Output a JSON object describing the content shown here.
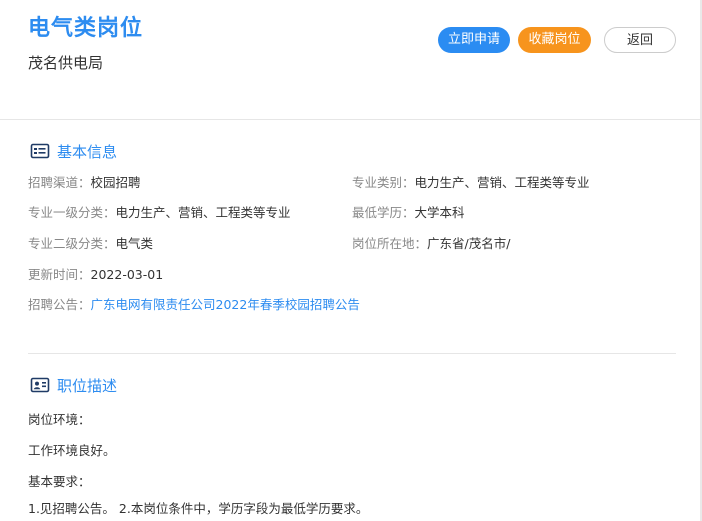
{
  "header": {
    "title": "电气类岗位",
    "company": "茂名供电局",
    "apply_label": "立即申请",
    "favorite_label": "收藏岗位",
    "back_label": "返回"
  },
  "basic_info": {
    "heading": "基本信息",
    "icon": "id-card-icon",
    "recruit_channel_key": "招聘渠道：",
    "recruit_channel_val": "校园招聘",
    "major_category_key": "专业类别：",
    "major_category_val": "电力生产、营销、工程类等专业",
    "major_l1_key": "专业一级分类：",
    "major_l1_val": "电力生产、营销、工程类等专业",
    "min_edu_key": "最低学历：",
    "min_edu_val": "大学本科",
    "major_l2_key": "专业二级分类：",
    "major_l2_val": "电气类",
    "location_key": "岗位所在地：",
    "location_val": "广东省/茂名市/",
    "updated_key": "更新时间：",
    "updated_val": "2022-03-01",
    "notice_key": "招聘公告：",
    "notice_link": "广东电网有限责任公司2022年春季校园招聘公告"
  },
  "job_desc": {
    "heading": "职位描述",
    "icon": "person-card-icon",
    "env_label": "岗位环境：",
    "env_text": "工作环境良好。",
    "req_label": "基本要求：",
    "req_text": "1.见招聘公告。 2.本岗位条件中，学历字段为最低学历要求。"
  },
  "colors": {
    "accent": "#2d8cf0",
    "apply": "#2b8cf2",
    "favorite": "#f7941d"
  }
}
